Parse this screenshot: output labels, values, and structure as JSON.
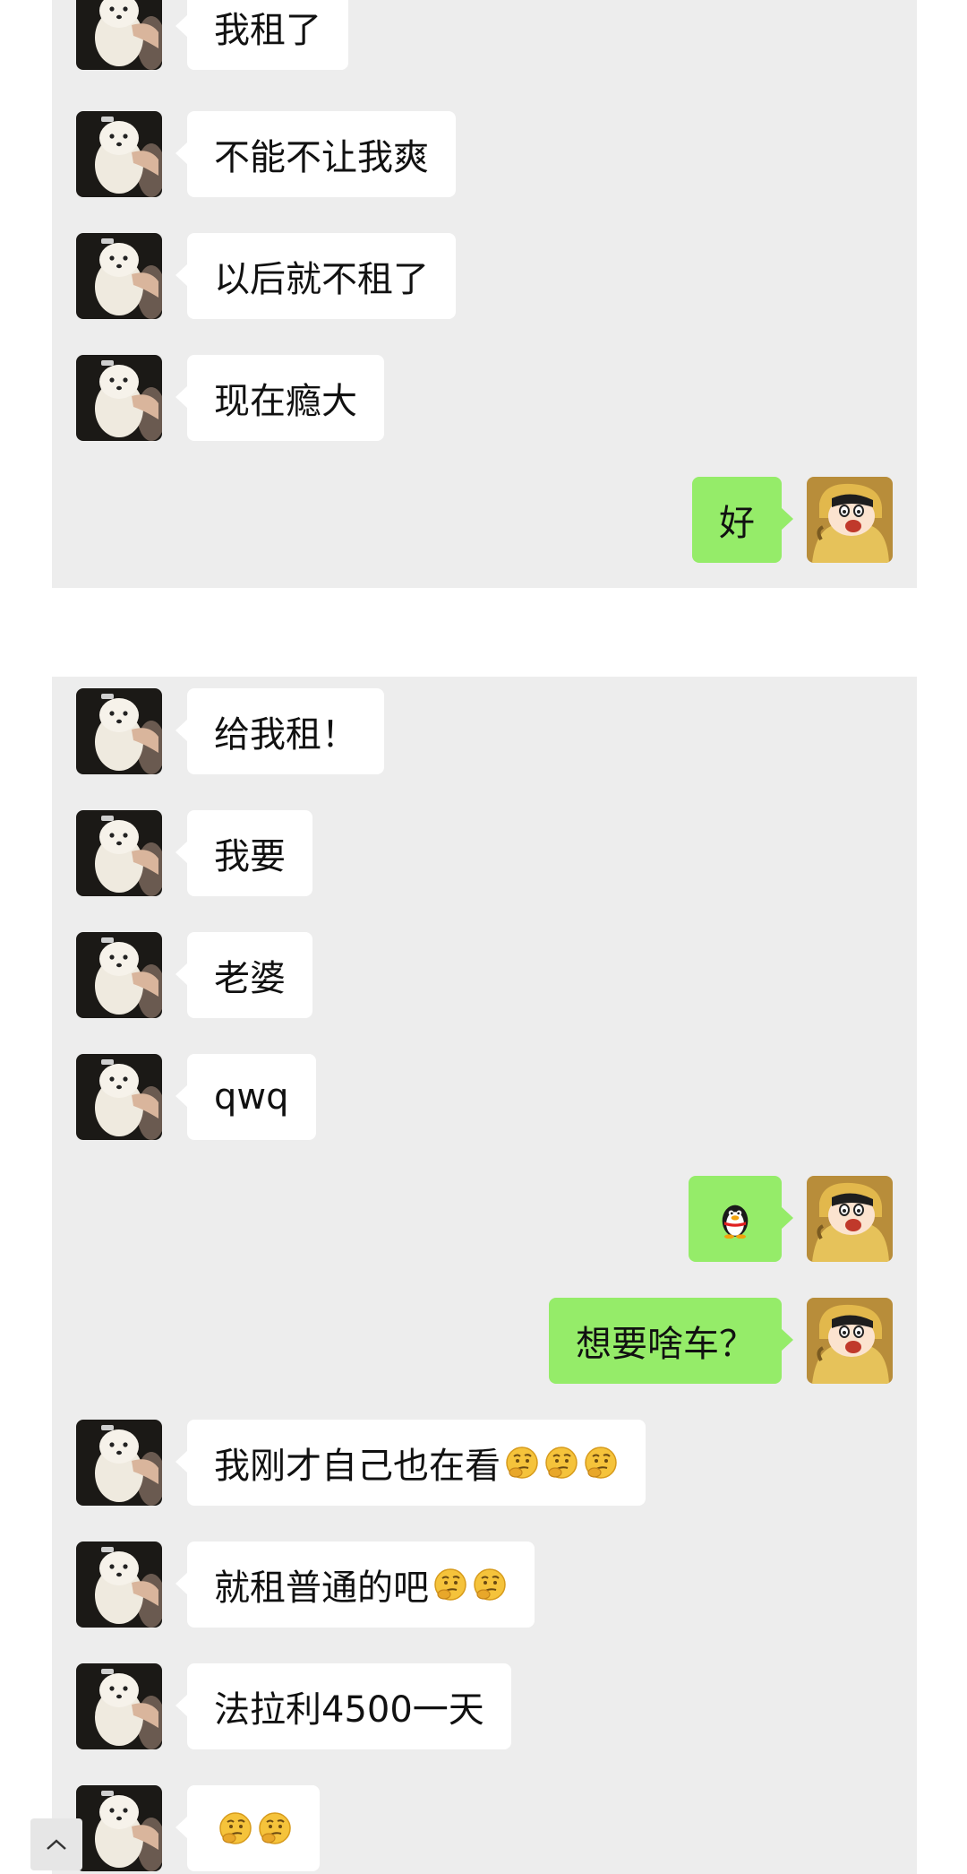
{
  "screenshot_1": {
    "messages": [
      {
        "side": "left",
        "text": "我租了"
      },
      {
        "side": "left",
        "text": "不能不让我爽"
      },
      {
        "side": "left",
        "text": "以后就不租了"
      },
      {
        "side": "left",
        "text": "现在瘾大"
      },
      {
        "side": "right",
        "text": "好"
      }
    ]
  },
  "screenshot_2": {
    "messages": [
      {
        "side": "left",
        "text": "给我租！"
      },
      {
        "side": "left",
        "text": "我要"
      },
      {
        "side": "left",
        "text": "老婆"
      },
      {
        "side": "left",
        "text": "qwq"
      },
      {
        "side": "right",
        "sticker": "penguin-emoji"
      },
      {
        "side": "right",
        "text": "想要啥车？"
      },
      {
        "side": "left",
        "text": "我刚才自己也在看",
        "emojis": [
          "thinking-emoji",
          "thinking-emoji",
          "thinking-emoji"
        ]
      },
      {
        "side": "left",
        "text": "就租普通的吧",
        "emojis": [
          "thinking-emoji",
          "thinking-emoji"
        ]
      },
      {
        "side": "left",
        "text": "法拉利4500一天"
      },
      {
        "side": "left",
        "text": "",
        "emojis": [
          "thinking-emoji",
          "thinking-emoji"
        ]
      }
    ]
  },
  "contacts": {
    "left_avatar": "white-puppy-avatar",
    "right_avatar": "crayon-shinchan-avatar"
  },
  "colors": {
    "panel_bg": "#ededed",
    "incoming_bubble": "#ffffff",
    "outgoing_bubble": "#95ec69"
  },
  "controls": {
    "scroll_top_icon": "chevron-up-icon"
  }
}
